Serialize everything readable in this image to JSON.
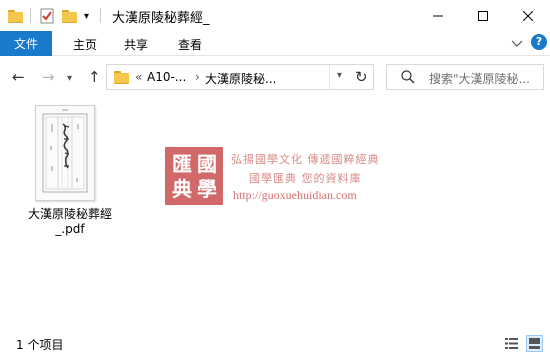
{
  "window": {
    "title": "大漢原陵秘葬經_",
    "controls": {
      "minimize": "—",
      "maximize": "☐",
      "close": "✕"
    },
    "qat_dropdown": "▾"
  },
  "ribbon": {
    "file_tab": "文件",
    "tabs": [
      "主页",
      "共享",
      "查看"
    ],
    "expand_chevron": "﹀",
    "help": "?"
  },
  "nav": {
    "back": "←",
    "forward": "→",
    "recent": "▾",
    "up": "↑",
    "breadcrumb_overflow": "«",
    "crumb1": "A10-...",
    "sep": "›",
    "crumb2": "大漢原陵秘...",
    "dropdown": "▾",
    "refresh": "↻",
    "search_placeholder": "搜索\"大漢原陵秘..."
  },
  "files": [
    {
      "name": "大漢原陵秘葬經_.pdf",
      "name_line1": "大漢原陵秘葬經",
      "name_line2": "_.pdf",
      "type": "pdf"
    }
  ],
  "watermark": {
    "seal_chars": [
      "匯",
      "國",
      "典",
      "學"
    ],
    "line1": "弘揚國學文化  傳遞國粹經典",
    "line2": "國學匯典  您的資料庫",
    "url": "http://guoxuehuidian.com"
  },
  "status": {
    "item_count": "1 个项目"
  },
  "colors": {
    "file_tab": "#1979ca",
    "folder": "#f3c84a",
    "seal": "#c9504e",
    "watermark_text": "#d88a86"
  }
}
